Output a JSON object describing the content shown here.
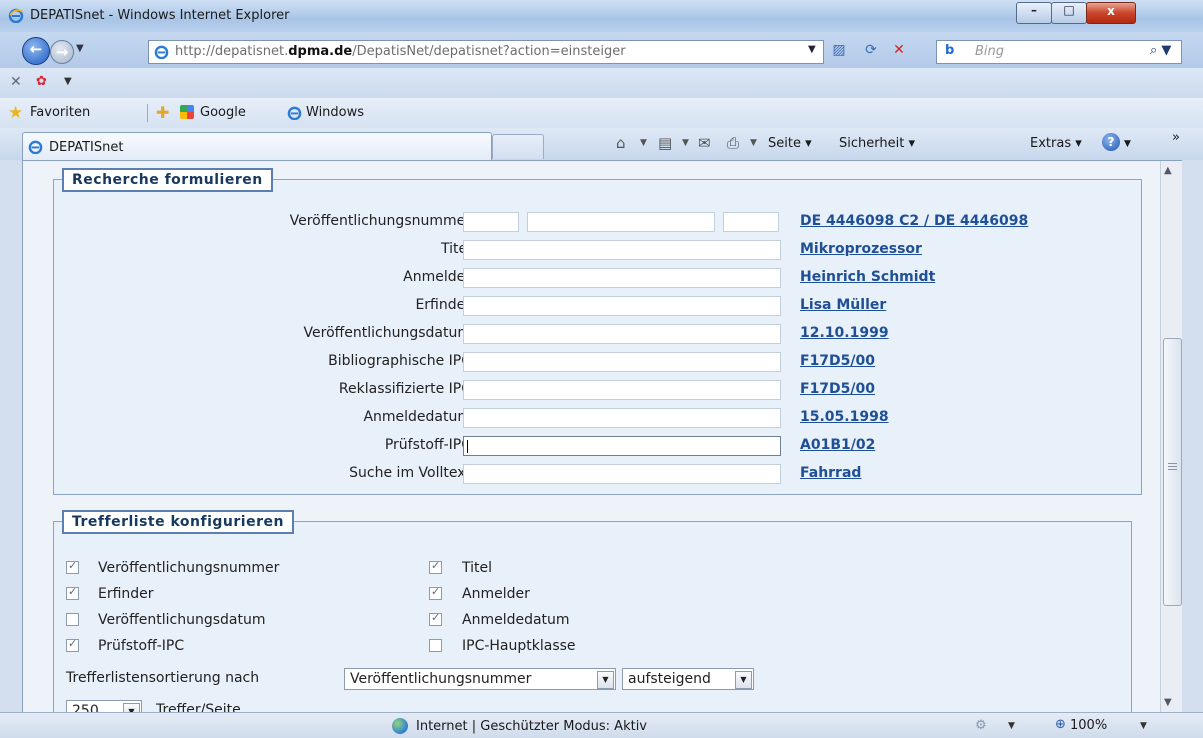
{
  "window": {
    "title": "DEPATISnet - Windows Internet Explorer",
    "min_glyph": "–",
    "max_glyph": "□",
    "close_glyph": "x"
  },
  "address": {
    "url_prefix": "http://depatisnet.",
    "url_domain": "dpma.de",
    "url_suffix": "/DepatisNet/depatisnet?action=einsteiger",
    "search_placeholder": "Bing",
    "search_engine_logo": "b"
  },
  "favorites": {
    "label": "Favoriten",
    "items": [
      "Google",
      "Windows"
    ]
  },
  "tab": {
    "label": "DEPATISnet"
  },
  "commandbar": {
    "seite": "Seite",
    "sicherheit": "Sicherheit",
    "extras": "Extras",
    "overflow": "»"
  },
  "form": {
    "legend": "Recherche formulieren",
    "fields": [
      {
        "label": "Veröffentlichungsnummer",
        "example": "DE 4446098 C2 / DE 4446098"
      },
      {
        "label": "Titel",
        "example": "Mikroprozessor"
      },
      {
        "label": "Anmelder",
        "example": "Heinrich Schmidt"
      },
      {
        "label": "Erfinder",
        "example": "Lisa Müller"
      },
      {
        "label": "Veröffentlichungsdatum",
        "example": "12.10.1999"
      },
      {
        "label": "Bibliographische IPC",
        "example": "F17D5/00"
      },
      {
        "label": "Reklassifizierte IPC",
        "example": "F17D5/00"
      },
      {
        "label": "Anmeldedatum",
        "example": "15.05.1998"
      },
      {
        "label": "Prüfstoff-IPC",
        "example": "A01B1/02"
      },
      {
        "label": "Suche im Volltext",
        "example": "Fahrrad"
      }
    ]
  },
  "results": {
    "legend": "Trefferliste konfigurieren",
    "options": [
      {
        "label": "Veröffentlichungsnummer",
        "checked": true
      },
      {
        "label": "Titel",
        "checked": true
      },
      {
        "label": "Erfinder",
        "checked": true
      },
      {
        "label": "Anmelder",
        "checked": true
      },
      {
        "label": "Veröffentlichungsdatum",
        "checked": false
      },
      {
        "label": "Anmeldedatum",
        "checked": true
      },
      {
        "label": "Prüfstoff-IPC",
        "checked": true
      },
      {
        "label": "IPC-Hauptklasse",
        "checked": false
      }
    ],
    "sort_label": "Trefferlistensortierung nach",
    "sort_field": "Veröffentlichungsnummer",
    "sort_order": "aufsteigend",
    "per_page_value": "250",
    "per_page_label": "Treffer/Seite"
  },
  "status": {
    "text": "Internet | Geschützter Modus: Aktiv",
    "zoom": "100%"
  },
  "colors": {
    "link": "#1f4f95",
    "legend_border": "#5a7fb0"
  }
}
